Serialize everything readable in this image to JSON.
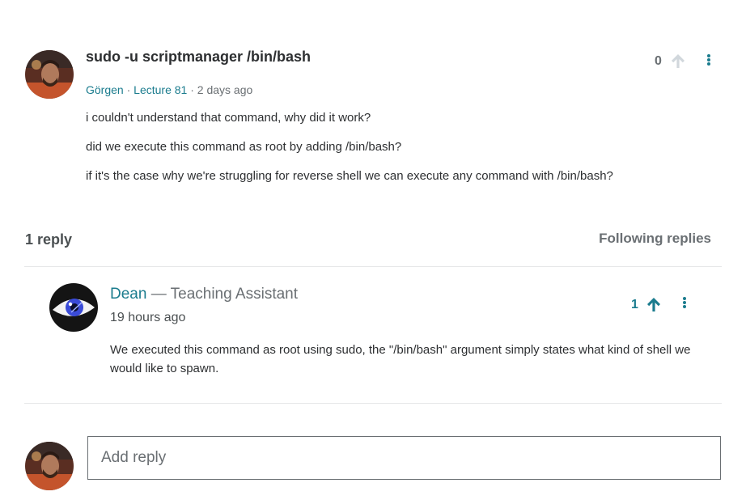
{
  "question": {
    "title": "sudo -u scriptmanager /bin/bash",
    "author": "Görgen",
    "lecture": "Lecture 81",
    "sep1": "·",
    "sep2": "·",
    "time": "2 days ago",
    "body": [
      "i couldn't understand that command,  why did it work?",
      "did we execute this command as root by adding /bin/bash?",
      "if it's the case why we're struggling for reverse shell we can execute any command with /bin/bash?"
    ],
    "votes": "0",
    "vote_icon": "arrow-up-icon",
    "more_icon": "more-vertical-icon"
  },
  "replies_header": {
    "count_label": "1 reply",
    "following_label": "Following replies"
  },
  "reply": {
    "author": "Dean",
    "role": " — Teaching Assistant",
    "time": "19 hours ago",
    "body": "We executed this command as root using sudo, the \"/bin/bash\" argument simply states what kind of shell we would like to spawn.",
    "votes": "1"
  },
  "add_reply": {
    "placeholder": "Add reply"
  },
  "colors": {
    "accent": "#1b7c8e",
    "muted": "#6a6f73",
    "text": "#2d2f31",
    "divider": "#e6e7e8",
    "upvote_inactive": "#d1d7dc"
  }
}
